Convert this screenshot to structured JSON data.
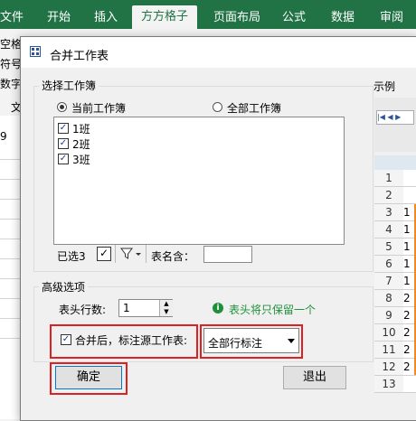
{
  "ribbon": {
    "tabs": [
      "文件",
      "开始",
      "插入",
      "方方格子",
      "页面布局",
      "公式",
      "数据",
      "审阅"
    ],
    "active_tab": "方方格子",
    "left_fragments": [
      "空格",
      "符号",
      "数字",
      "文"
    ],
    "row_fragment": "9"
  },
  "dialog": {
    "title": "合并工作表",
    "select_group": {
      "label": "选择工作簿",
      "radio_current": "当前工作簿",
      "radio_all": "全部工作簿",
      "sheets": [
        {
          "name": "1班",
          "checked": true
        },
        {
          "name": "2班",
          "checked": true
        },
        {
          "name": "3班",
          "checked": true
        }
      ],
      "selected_count": "已选3",
      "sheet_name_contains_label": "表名含："
    },
    "preview_label": "示例",
    "advanced": {
      "label": "高级选项",
      "header_rows_label": "表头行数:",
      "header_rows_value": "1",
      "info_text": "表头将只保留一个",
      "mark_source_label": "合并后，标注源工作表:",
      "mark_source_checked": true,
      "mark_source_option": "全部行标注"
    },
    "ok_button": "确定",
    "exit_button": "退出"
  },
  "preview": {
    "rows": [
      "1",
      "2",
      "3",
      "4",
      "5",
      "6",
      "7",
      "8",
      "9",
      "10",
      "11",
      "12",
      "13"
    ],
    "col_a": [
      "",
      "",
      "1",
      "1",
      "1",
      "1",
      "1",
      "2",
      "2",
      "2",
      "2",
      "2",
      ""
    ]
  },
  "colors": {
    "ribbon": "#217346",
    "highlight": "#e02020",
    "info": "#1f8f3a"
  }
}
